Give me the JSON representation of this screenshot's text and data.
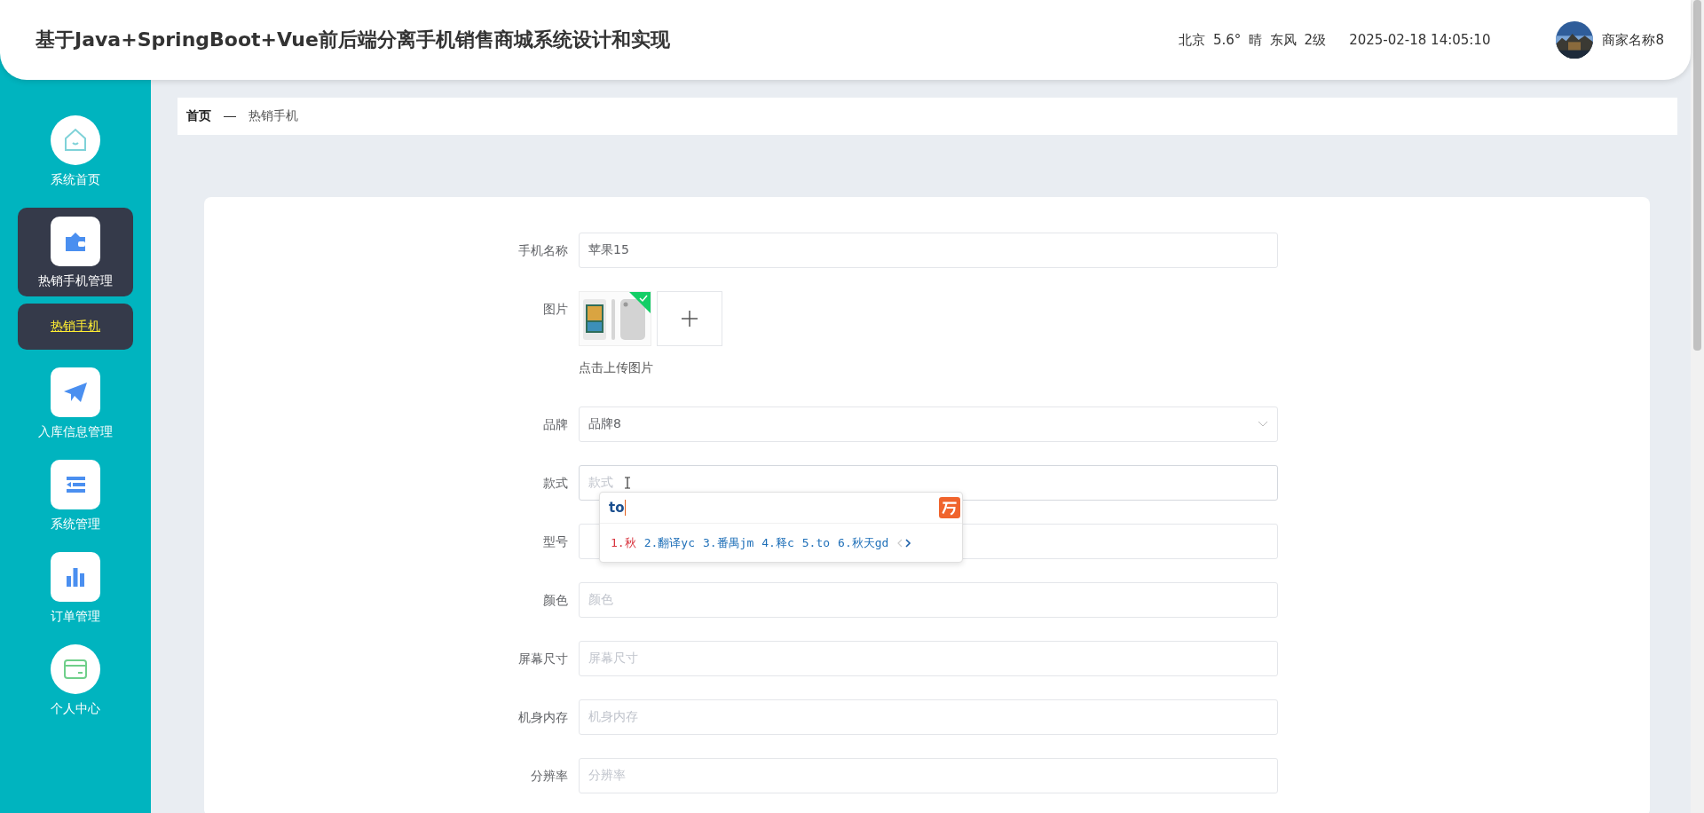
{
  "header": {
    "title": "基于Java+SpringBoot+Vue前后端分离手机销售商城系统设计和实现",
    "weather": "北京 5.6° 晴 东风 2级",
    "datetime": "2025-02-18 14:05:10",
    "user": "商家名称8"
  },
  "sidebar": {
    "items": [
      {
        "kind": "home",
        "label": "系统首页",
        "selected": false
      },
      {
        "kind": "wallet",
        "label": "热销手机管理",
        "selected": true,
        "children": [
          {
            "label": "热销手机",
            "selected": true
          }
        ]
      },
      {
        "kind": "send",
        "label": "入库信息管理",
        "selected": false
      },
      {
        "kind": "list",
        "label": "系统管理",
        "selected": false
      },
      {
        "kind": "chart",
        "label": "订单管理",
        "selected": false
      },
      {
        "kind": "card",
        "label": "个人中心",
        "selected": false
      }
    ]
  },
  "breadcrumb": [
    "首页",
    "热销手机"
  ],
  "form": {
    "fields": [
      {
        "kind": "text",
        "label": "手机名称",
        "value": "苹果15"
      },
      {
        "label": "图片",
        "uploaded": true,
        "note": "点击上传图片"
      },
      {
        "kind": "select",
        "label": "品牌",
        "value": "品牌8"
      },
      {
        "kind": "text",
        "label": "款式",
        "placeholder": "款式",
        "focused": true
      },
      {
        "kind": "text",
        "label": "型号"
      },
      {
        "kind": "text",
        "label": "颜色",
        "placeholder": "颜色"
      },
      {
        "kind": "text",
        "label": "屏幕尺寸",
        "placeholder": "屏幕尺寸"
      },
      {
        "kind": "text",
        "label": "机身内存",
        "placeholder": "机身内存"
      },
      {
        "kind": "text",
        "label": "分辨率",
        "placeholder": "分辨率"
      }
    ]
  },
  "ime": {
    "input": "to",
    "candidates": [
      {
        "text": "1.秋",
        "selected": true
      },
      {
        "text": "2.翻译yc",
        "selected": false
      },
      {
        "text": "3.番禺jm",
        "selected": false
      },
      {
        "text": "4.释c",
        "selected": false
      },
      {
        "text": "5.to",
        "selected": false
      },
      {
        "text": "6.秋天gd",
        "selected": false
      }
    ]
  }
}
